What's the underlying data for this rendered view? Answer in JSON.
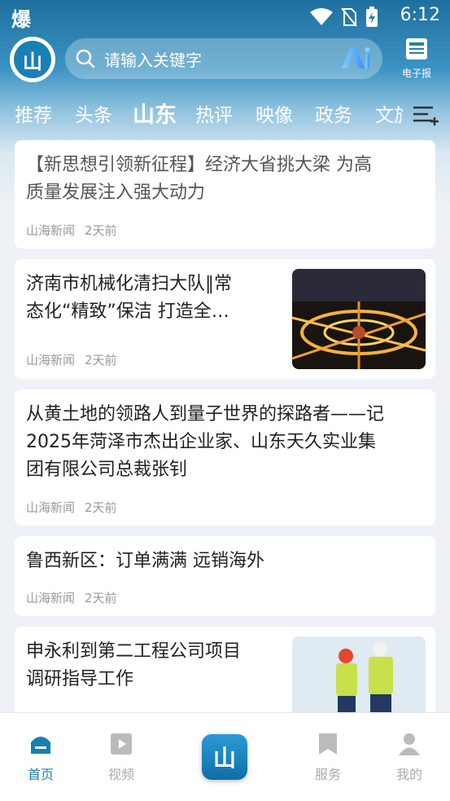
{
  "status_bar": {
    "carrier_glyph": "爆",
    "time": "6:12"
  },
  "header": {
    "logo_text": "山",
    "search_placeholder": "请输入关键字",
    "ai_label": "Ai",
    "epaper_label": "电子报"
  },
  "tabs": [
    {
      "label": "推荐",
      "active": false
    },
    {
      "label": "头条",
      "active": false
    },
    {
      "label": "山东",
      "active": true
    },
    {
      "label": "热评",
      "active": false
    },
    {
      "label": "映像",
      "active": false
    },
    {
      "label": "政务",
      "active": false
    },
    {
      "label": "文旅",
      "active": false
    }
  ],
  "articles": [
    {
      "title_lines": [
        "【新思想引领新征程】经济大省挑大梁 为高",
        "质量发展注入强大动力"
      ],
      "source": "山海新闻",
      "time": "2天前"
    },
    {
      "title_lines": [
        "济南市机械化清扫大队‖常",
        "态化“精致”保洁 打造全…"
      ],
      "source": "山海新闻",
      "time": "2天前",
      "thumb": "night-interchange-photo"
    },
    {
      "title_lines": [
        "从黄土地的领路人到量子世界的探路者——记",
        "2025年菏泽市杰出企业家、山东天久实业集",
        "团有限公司总裁张钊"
      ],
      "source": "山海新闻",
      "time": "2天前"
    },
    {
      "title_lines": [
        "鲁西新区：订单满满 远销海外"
      ],
      "source": "山海新闻",
      "time": "2天前"
    },
    {
      "title_lines": [
        "申永利到第二工程公司项目",
        "调研指导工作"
      ],
      "thumb": "workers-photo"
    }
  ],
  "bottom_nav": [
    {
      "label": "首页",
      "icon": "home-icon",
      "active": true
    },
    {
      "label": "视频",
      "icon": "video-play-icon",
      "active": false
    },
    {
      "label": "服务",
      "icon": "bookmark-icon",
      "active": false
    },
    {
      "label": "我的",
      "icon": "person-icon",
      "active": false
    }
  ],
  "colors": {
    "accent": "#1a7fb3",
    "header_bg": "#1e6f9f",
    "meta_text": "#999999"
  }
}
